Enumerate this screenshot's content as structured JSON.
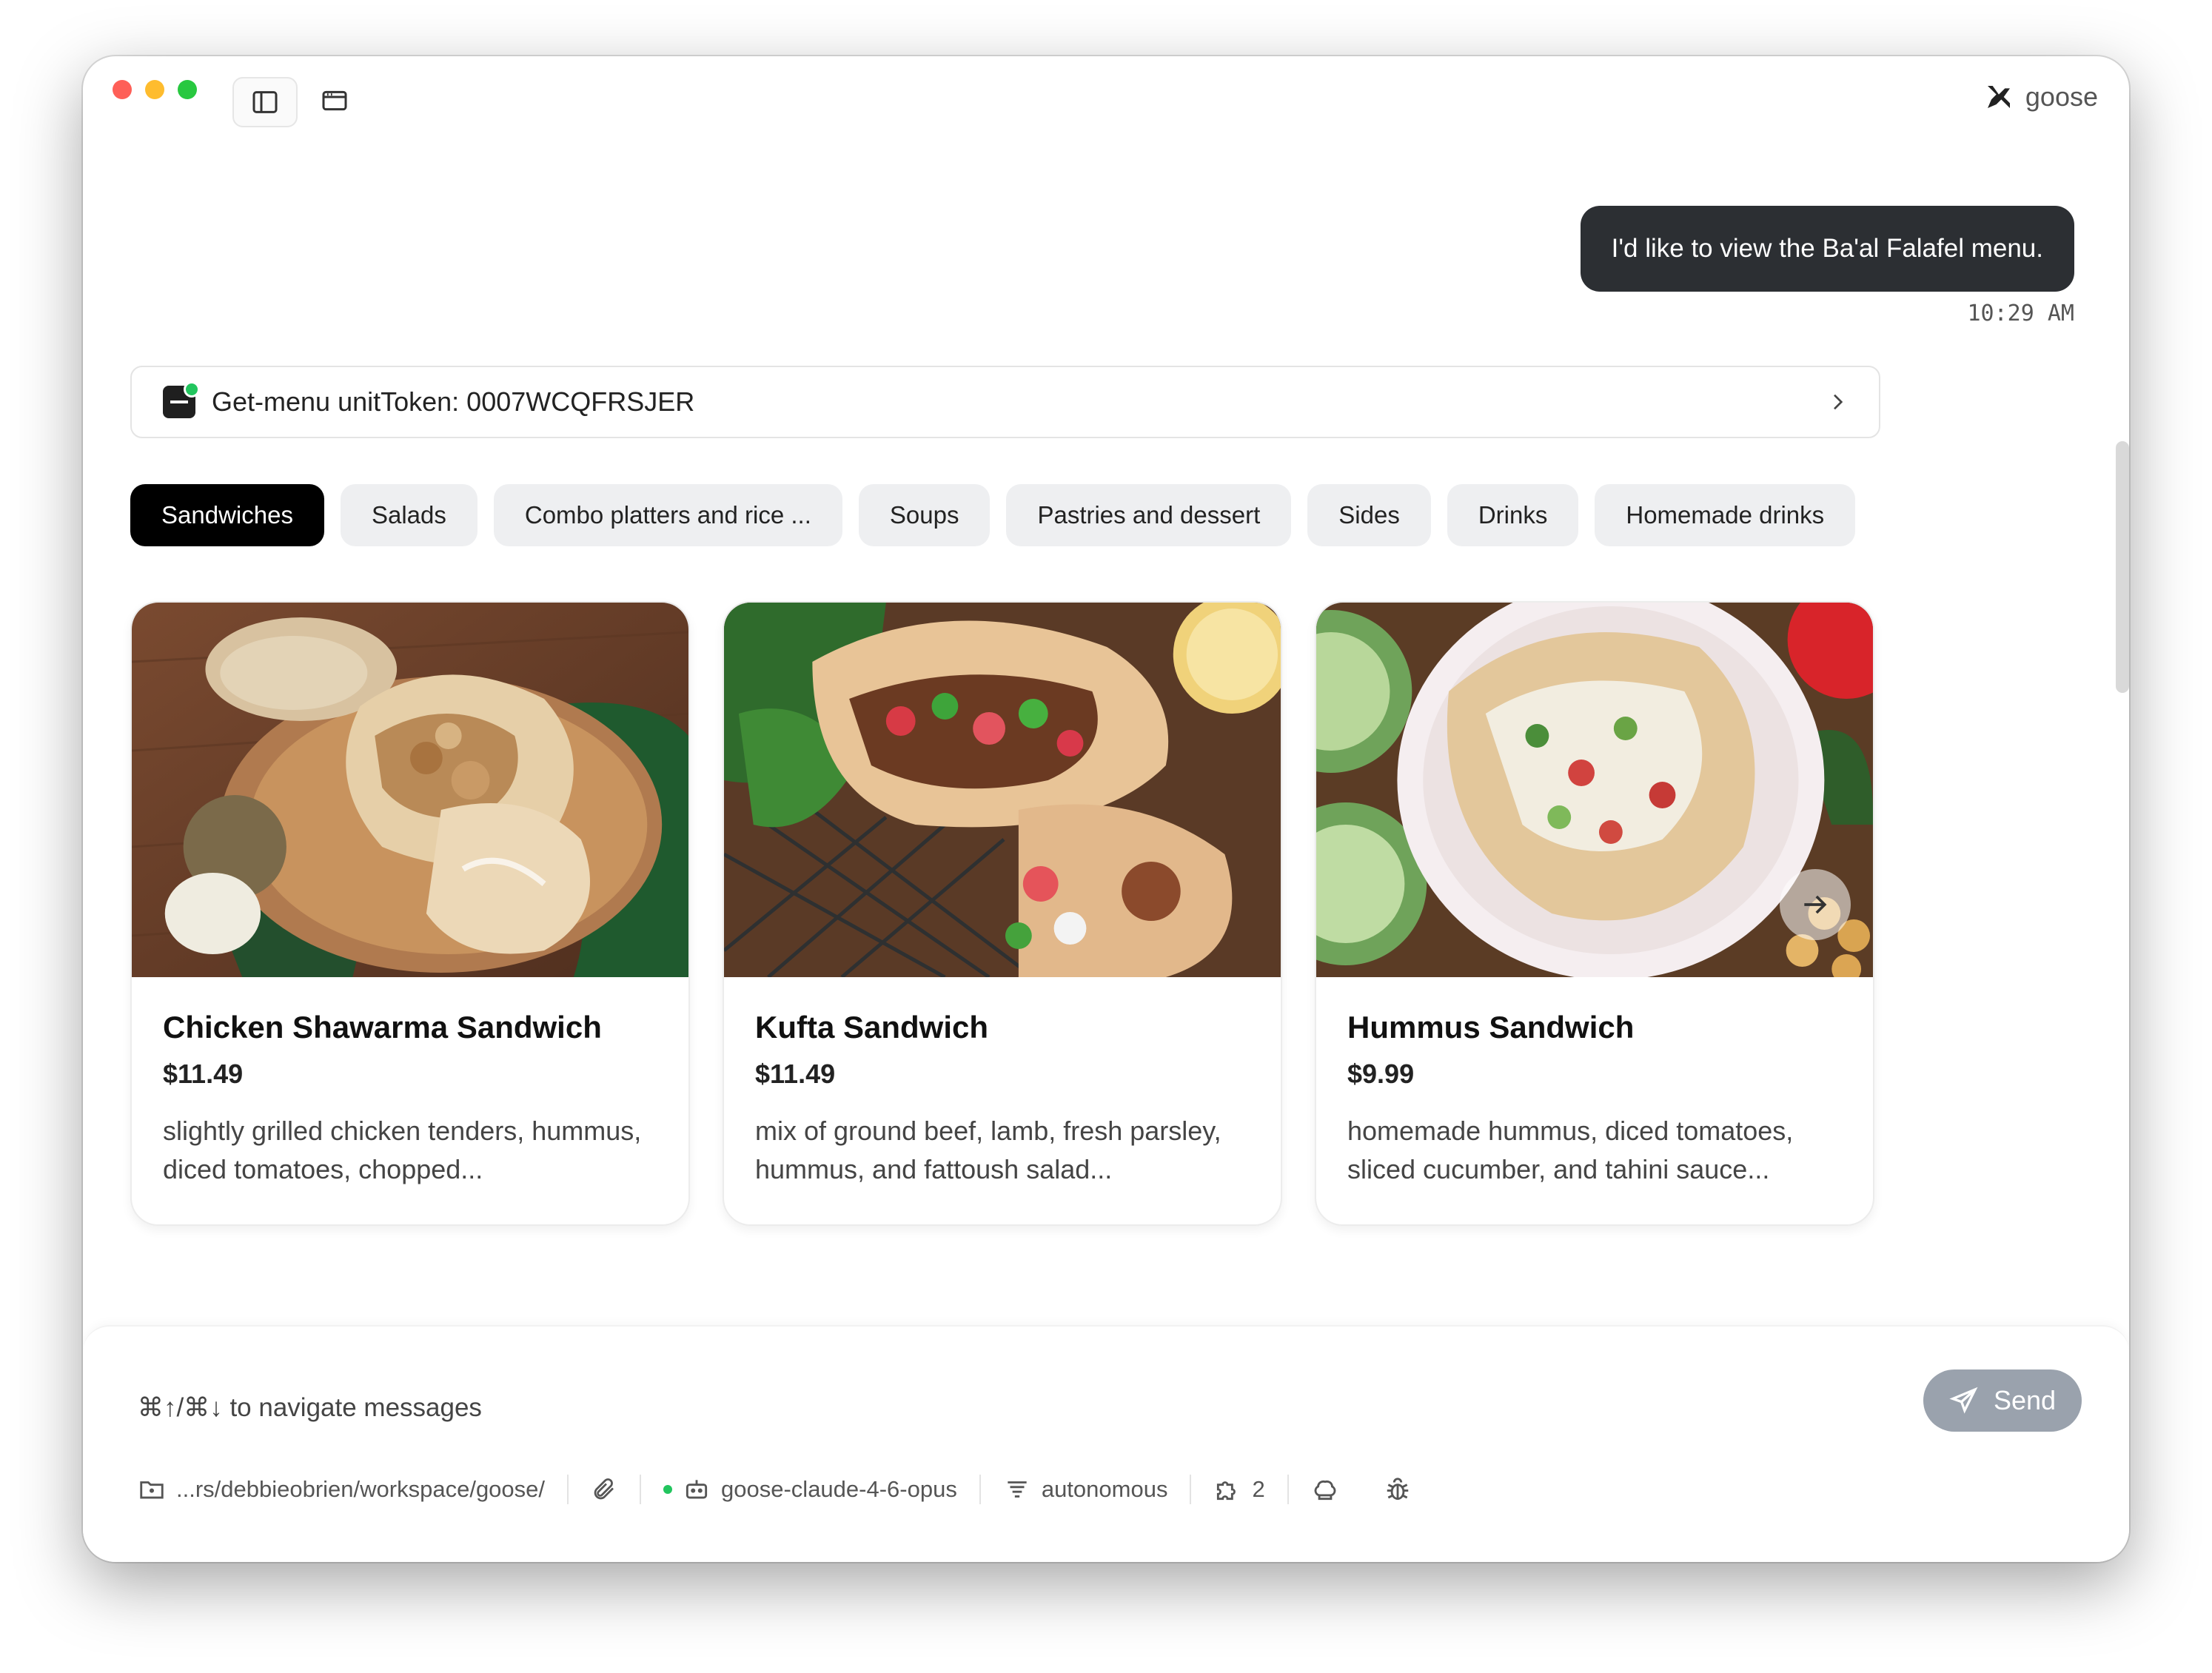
{
  "app": {
    "name": "goose"
  },
  "conversation": {
    "user_message": "I'd like to view the Ba'al Falafel menu.",
    "time": "10:29 AM",
    "tool_call": {
      "label": "Get-menu unitToken: 0007WCQFRSJER"
    }
  },
  "menu": {
    "tabs": [
      {
        "label": "Sandwiches",
        "active": true
      },
      {
        "label": "Salads"
      },
      {
        "label": "Combo platters and rice ..."
      },
      {
        "label": "Soups"
      },
      {
        "label": "Pastries and dessert"
      },
      {
        "label": "Sides"
      },
      {
        "label": "Drinks"
      },
      {
        "label": "Homemade drinks"
      }
    ],
    "items": [
      {
        "name": "Chicken Shawarma Sandwich",
        "price": "$11.49",
        "description": "slightly grilled chicken tenders, hummus, diced tomatoes, chopped...",
        "image": "chicken-shawarma-photo"
      },
      {
        "name": "Kufta Sandwich",
        "price": "$11.49",
        "description": "mix of ground beef, lamb, fresh parsley, hummus, and fattoush salad...",
        "image": "kufta-sandwich-photo"
      },
      {
        "name": "Hummus Sandwich",
        "price": "$9.99",
        "description": "homemade hummus, diced tomatoes, sliced cucumber, and tahini sauce...",
        "image": "hummus-sandwich-photo"
      }
    ]
  },
  "composer": {
    "hint": "⌘↑/⌘↓ to navigate messages",
    "send_label": "Send"
  },
  "footer": {
    "directory": "...rs/debbieobrien/workspace/goose/",
    "model": "goose-claude-4-6-opus",
    "mode": "autonomous",
    "extensions_count": "2"
  },
  "colors": {
    "user_bubble": "#2c2f33",
    "active_tab": "#000000",
    "send_button": "#9aa2ad",
    "status_green": "#22c55e"
  }
}
